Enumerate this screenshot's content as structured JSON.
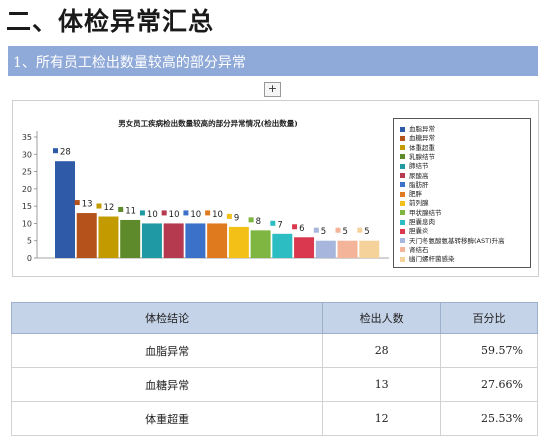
{
  "page": {
    "section_title": "二、体检异常汇总",
    "banner_title": "1、所有员工检出数量较高的部分异常",
    "expand_symbol": "+"
  },
  "chart_data": {
    "type": "bar",
    "title": "男女员工疾病检出数量较高的部分异常情况(检出数量)",
    "categories": [
      "血脂异常",
      "血糖异常",
      "体重超重",
      "乳腺结节",
      "肺结节",
      "尿酸高",
      "脂肪肝",
      "肥胖",
      "前列腺",
      "甲状腺结节",
      "胆囊息肉",
      "胆囊炎",
      "天门冬氨酸氨基转移酶(AST)升高",
      "肾结石",
      "幽门螺杆菌感染"
    ],
    "values": [
      28,
      13,
      12,
      11,
      10,
      10,
      10,
      10,
      9,
      8,
      7,
      6,
      5,
      5,
      5
    ],
    "colors": [
      "#2e5aa8",
      "#b5521c",
      "#c39a00",
      "#5e8a2c",
      "#1f9aa5",
      "#b53a4f",
      "#3b71c9",
      "#e07a1f",
      "#f3c017",
      "#7fb641",
      "#2bbdc1",
      "#d9384f",
      "#a6b6dc",
      "#f3b49a",
      "#f5d29a"
    ],
    "ylim": [
      0,
      35
    ],
    "yticks": [
      0,
      5,
      10,
      15,
      20,
      25,
      30,
      35
    ],
    "legend_position": "right",
    "grid": false
  },
  "table": {
    "headers": [
      "体检结论",
      "检出人数",
      "百分比"
    ],
    "rows": [
      [
        "血脂异常",
        "28",
        "59.57%"
      ],
      [
        "血糖异常",
        "13",
        "27.66%"
      ],
      [
        "体重超重",
        "12",
        "25.53%"
      ]
    ]
  }
}
